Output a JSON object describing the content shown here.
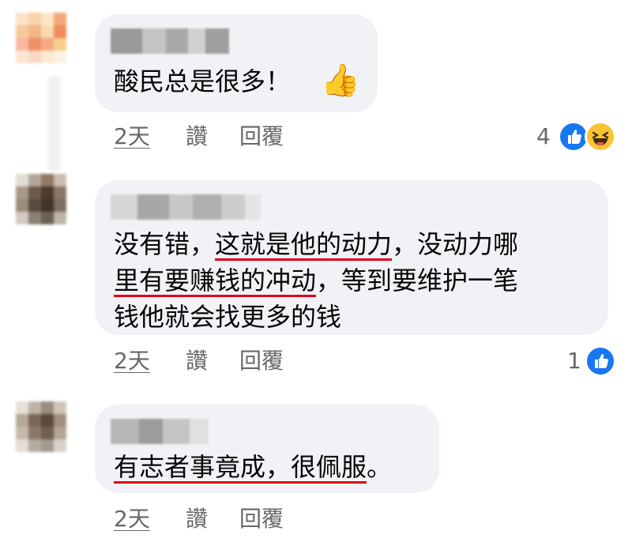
{
  "comments": [
    {
      "text": "酸民总是很多！",
      "emoji": "👍",
      "time": "2天",
      "like": "讚",
      "reply": "回覆",
      "reaction_count": "4",
      "reactions": [
        "like-icon",
        "haha-icon"
      ]
    },
    {
      "line1_a": "没有错，",
      "line1_b": "这就是他的动力",
      "line1_c": "，没动力哪",
      "line2_a": "里有要赚钱的冲动",
      "line2_b": "，等到要维护一笔",
      "line3": "钱他就会找更多的钱",
      "time": "2天",
      "like": "讚",
      "reply": "回覆",
      "reaction_count": "1",
      "reactions": [
        "like-icon"
      ]
    },
    {
      "text_a": "有志者事竟成，很佩服",
      "text_b": "。",
      "time": "2天",
      "like": "讚",
      "reply": "回覆"
    }
  ],
  "colors": {
    "bubble": "#f0f2f5",
    "text": "#050505",
    "meta": "#65676b",
    "underline": "#e0001a",
    "like": "#1877f2",
    "haha": "#f7c433"
  }
}
